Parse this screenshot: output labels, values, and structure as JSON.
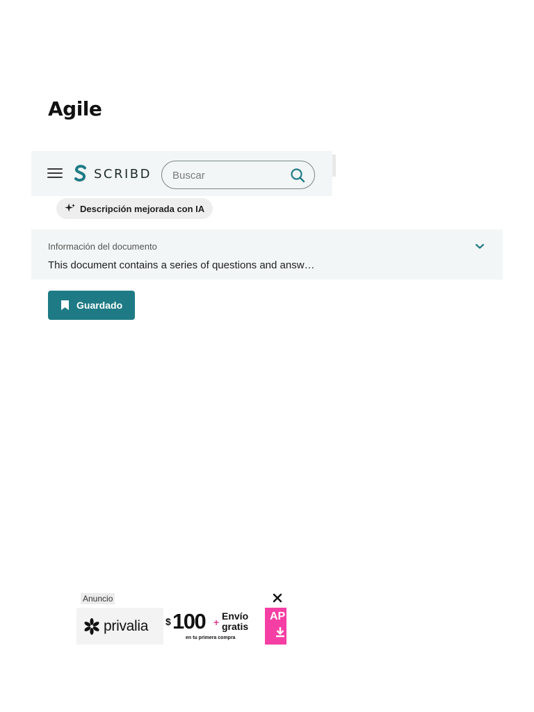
{
  "document": {
    "title": "Agile"
  },
  "header": {
    "logo_text": "SCRIBD",
    "search": {
      "placeholder": "Buscar",
      "value": ""
    },
    "icons": [
      "hamburger-menu-icon",
      "scribd-logo-icon",
      "search-icon"
    ]
  },
  "ai_chip": {
    "label": "Descripción mejorada con IA",
    "icon": "sparkle-icon"
  },
  "doc_info": {
    "heading": "Información del documento",
    "description": "This document contains a series of questions and answ…",
    "icon": "chevron-down-icon"
  },
  "actions": {
    "saved_label": "Guardado",
    "saved_icon": "bookmark-icon"
  },
  "ad": {
    "label": "Anuncio",
    "close_icon": "close-icon",
    "brand": "privalia",
    "currency": "$",
    "amount": "100",
    "plus": "+",
    "free_line1": "Envío",
    "free_line2": "gratis",
    "fine_print": "en tu primera compra",
    "cta_partial": "AP"
  },
  "colors": {
    "accent": "#1e7b85",
    "bar_bg": "#f3f6f6",
    "chip_bg": "#eeeeee",
    "ad_pink": "#f53fa4"
  }
}
